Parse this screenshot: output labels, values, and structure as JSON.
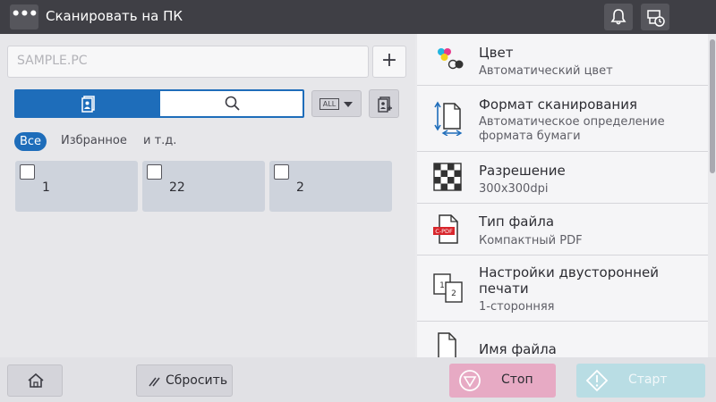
{
  "header": {
    "title": "Сканировать на ПК",
    "menu_icon": "more-dots-icon",
    "bell_icon": "bell-icon",
    "status_icon": "job-status-icon"
  },
  "address": {
    "placeholder": "SAMPLE.PC",
    "add_label": "+"
  },
  "address_book": {
    "tabs": [
      {
        "name": "address-book",
        "icon": "address-book-icon",
        "selected": true
      },
      {
        "name": "search",
        "icon": "search-icon",
        "selected": false
      }
    ],
    "index_selector": "ALL",
    "filters": [
      "Все",
      "Избранное",
      "и т.д."
    ],
    "destinations": [
      {
        "number": "1"
      },
      {
        "number": "22"
      },
      {
        "number": "2"
      }
    ]
  },
  "settings": [
    {
      "label": "Цвет",
      "value": "Автоматический цвет",
      "icon": "color-icon"
    },
    {
      "label": "Формат сканирования",
      "value": "Автоматическое определение формата бумаги",
      "icon": "scan-size-icon"
    },
    {
      "label": "Разрешение",
      "value": "300x300dpi",
      "icon": "resolution-icon"
    },
    {
      "label": "Тип файла",
      "value": "Компактный PDF",
      "icon": "file-type-icon",
      "badge": "C-PDF"
    },
    {
      "label": "Настройки двусторонней печати",
      "value": "1-сторонняя",
      "icon": "duplex-icon"
    },
    {
      "label": "Имя файла",
      "value": "",
      "icon": "file-name-icon"
    }
  ],
  "bottom": {
    "home_icon": "home-icon",
    "reset_label": "Сбросить",
    "stop_label": "Стоп",
    "start_label": "Старт"
  },
  "colors": {
    "accent": "#1e6dba",
    "header": "#3f3f45",
    "stop": "#e7aac4",
    "start": "#b9dde4"
  }
}
